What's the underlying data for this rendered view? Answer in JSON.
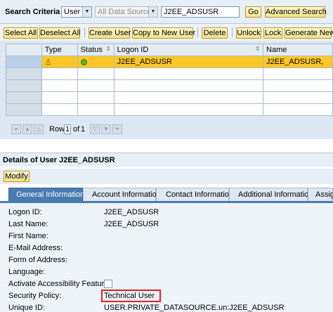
{
  "search": {
    "label": "Search Criteria",
    "type_value": "User",
    "source_value": "All Data Sources",
    "query": "J2EE_ADSUSR",
    "go": "Go",
    "advanced": "Advanced Search"
  },
  "toolbar": {
    "select_all": "Select All",
    "deselect_all": "Deselect All",
    "create_user": "Create User",
    "copy_to_new_user": "Copy to New User",
    "delete": "Delete",
    "unlock": "Unlock",
    "lock": "Lock",
    "generate_new": "Generate New"
  },
  "table": {
    "headers": [
      "Type",
      "Status",
      "Logon ID",
      "Name"
    ],
    "rows": [
      {
        "logon_id": "J2EE_ADSUSR",
        "name": "J2EE_ADSUSR,"
      }
    ],
    "pager": {
      "row_label": "Row",
      "row": "1",
      "of_label": "of",
      "total": "1"
    }
  },
  "details": {
    "title": "Details of User J2EE_ADSUSR",
    "modify": "Modify",
    "tabs": [
      "General Information",
      "Account Information",
      "Contact Information",
      "Additional Information",
      "Assig"
    ],
    "fields": {
      "logon_id": {
        "label": "Logon ID:",
        "value": "J2EE_ADSUSR"
      },
      "last_name": {
        "label": "Last Name:",
        "value": "J2EE_ADSUSR"
      },
      "first_name": {
        "label": "First Name:",
        "value": ""
      },
      "email": {
        "label": "E-Mail Address:",
        "value": ""
      },
      "form_of_address": {
        "label": "Form of Address:",
        "value": ""
      },
      "language": {
        "label": "Language:",
        "value": ""
      },
      "accessibility": {
        "label": "Activate Accessibility Feature:"
      },
      "security_policy": {
        "label": "Security Policy:",
        "value": "Technical User"
      },
      "unique_id": {
        "label": "Unique ID:",
        "value": "USER.PRIVATE_DATASOURCE.un:J2EE_ADSUSR"
      }
    }
  },
  "colors": {
    "highlight_row": "#ffc726",
    "active_tab": "#4a7bb1",
    "callout": "#e02020"
  }
}
